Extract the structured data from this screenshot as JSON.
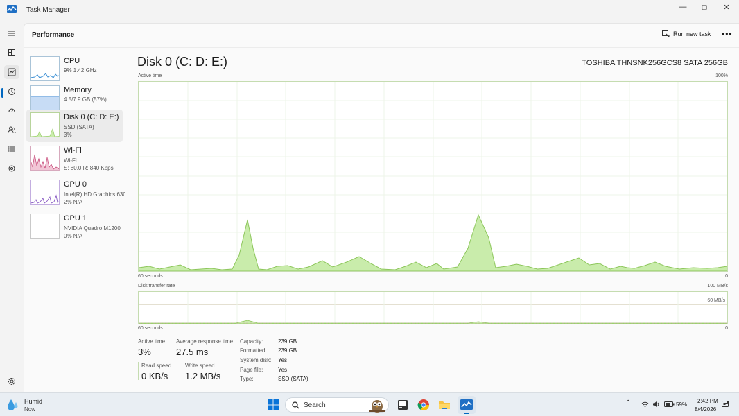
{
  "window": {
    "title": "Task Manager",
    "controls": [
      "—",
      "▢",
      "✕"
    ]
  },
  "rail": {
    "items": [
      "menu-icon",
      "processes-icon",
      "performance-icon",
      "app-history-icon",
      "startup-apps-icon",
      "users-icon",
      "details-icon",
      "services-icon",
      "settings-icon"
    ]
  },
  "header": {
    "title": "Performance",
    "run_task": "Run new task",
    "more": "•••"
  },
  "devices": [
    {
      "name": "CPU",
      "line1": "9%  1.42 GHz",
      "line2": ""
    },
    {
      "name": "Memory",
      "line1": "4.5/7.9 GB (57%)",
      "line2": ""
    },
    {
      "name": "Disk 0 (C: D: E:)",
      "line1": "SSD (SATA)",
      "line2": "3%"
    },
    {
      "name": "Wi-Fi",
      "line1": "Wi-Fi",
      "line2": "S: 80.0  R: 840 Kbps"
    },
    {
      "name": "GPU 0",
      "line1": "Intel(R) HD Graphics 630",
      "line2": "2%  N/A"
    },
    {
      "name": "GPU 1",
      "line1": "NVIDIA Quadro M1200",
      "line2": "0%  N/A"
    }
  ],
  "detail": {
    "title": "Disk 0 (C: D: E:)",
    "model": "TOSHIBA THNSNK256GCS8 SATA 256GB",
    "active_graph": {
      "label": "Active time",
      "max": "100%",
      "x_left": "60 seconds",
      "x_right": "0"
    },
    "transfer_graph": {
      "label": "Disk transfer rate",
      "max": "100 MB/s",
      "mid": "60 MB/s",
      "x_left": "60 seconds",
      "x_right": "0"
    },
    "stats": {
      "active_time_label": "Active time",
      "active_time_value": "3%",
      "avg_response_label": "Average response time",
      "avg_response_value": "27.5 ms",
      "read_speed_label": "Read speed",
      "read_speed_value": "0 KB/s",
      "write_speed_label": "Write speed",
      "write_speed_value": "1.2 MB/s"
    },
    "properties": [
      {
        "label": "Capacity:",
        "value": "239 GB"
      },
      {
        "label": "Formatted:",
        "value": "239 GB"
      },
      {
        "label": "System disk:",
        "value": "Yes"
      },
      {
        "label": "Page file:",
        "value": "Yes"
      },
      {
        "label": "Type:",
        "value": "SSD (SATA)"
      }
    ]
  },
  "taskbar": {
    "weather_title": "Humid",
    "weather_sub": "Now",
    "search_label": "Search",
    "battery": "59%",
    "time": "2:42 PM",
    "date": "8/4/2026"
  },
  "colors": {
    "accent": "#0067c0",
    "disk_fill": "#c9ecab",
    "disk_line": "#8cc65a"
  }
}
